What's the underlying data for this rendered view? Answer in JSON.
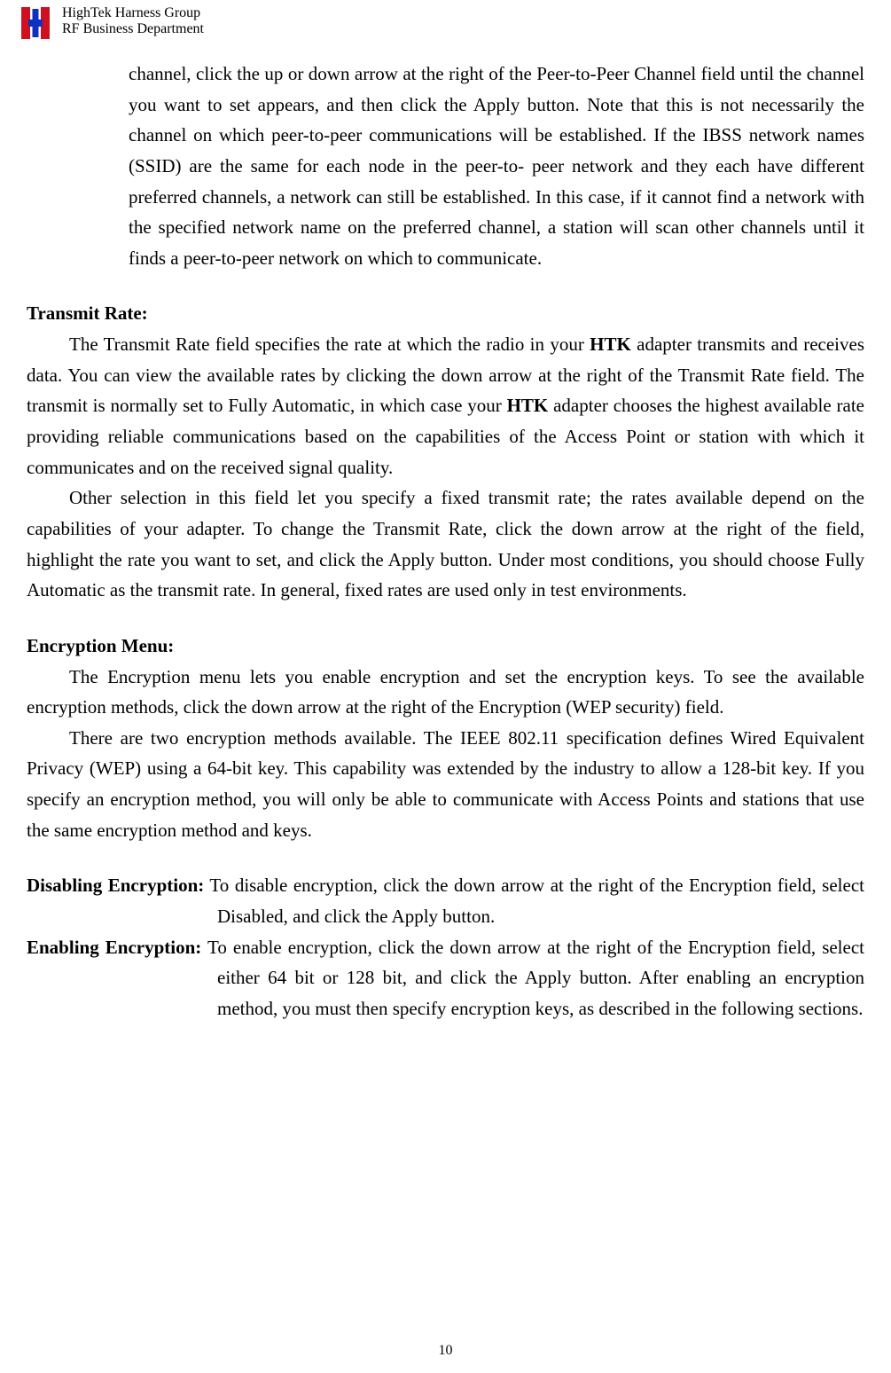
{
  "header": {
    "line1": "HighTek Harness Group",
    "line2": "RF Business Department"
  },
  "top_continued_paragraph": "channel, click the up or down arrow at the right of the Peer-to-Peer Channel field until the channel you want to set appears, and then click the Apply button. Note that this is not necessarily the channel on which peer-to-peer communications will be established. If the IBSS network names (SSID) are the same for each node in the peer-to- peer network and they each have different preferred channels, a network can still be established.  In this case, if it cannot find a network with the specified network name on the preferred channel, a station will scan other channels until it finds a peer-to-peer network on which to communicate.",
  "sections": {
    "transmit_rate": {
      "title": "Transmit Rate:",
      "p1_pre": "The Transmit Rate field specifies the rate at which the radio in your ",
      "p1_bold1": "HTK",
      "p1_mid": " adapter transmits and receives data. You can view the available rates by clicking the down arrow at the right of the Transmit Rate field. The transmit is normally set to Fully Automatic, in which case your ",
      "p1_bold2": "HTK",
      "p1_post": " adapter chooses the highest available rate providing reliable communications based on the capabilities of the Access Point or station with which it communicates and on the received signal quality.",
      "p2": "Other selection in this field let you specify a fixed transmit rate; the rates available depend on the capabilities of your adapter. To change the Transmit Rate, click the down arrow at the right of the field, highlight the rate you want to set, and click the Apply button. Under most conditions, you should choose Fully Automatic as the transmit rate. In general, fixed rates are used only in test environments."
    },
    "encryption_menu": {
      "title": "Encryption Menu:",
      "p1": "The Encryption menu lets you enable encryption and set the encryption keys. To see the available encryption methods, click the down arrow at the right of the Encryption (WEP security) field.",
      "p2": "There are two encryption methods available. The IEEE 802.11 specification defines Wired Equivalent Privacy (WEP) using a 64-bit key. This capability was extended by the industry to allow a 128-bit key. If you specify an encryption method, you will only be able to communicate with Access Points and stations that use the same encryption method and keys."
    },
    "disable_enc": {
      "label": "Disabling Encryption:",
      "text": " To disable encryption, click the down arrow at the right of the Encryption field, select Disabled, and click the Apply button."
    },
    "enable_enc": {
      "label": "Enabling Encryption:",
      "text": " To enable encryption, click the down arrow at the right of the Encryption field, select either 64 bit or 128 bit, and click the Apply button. After enabling an encryption method, you must then specify encryption keys, as described in the following sections."
    }
  },
  "page_number": "10"
}
